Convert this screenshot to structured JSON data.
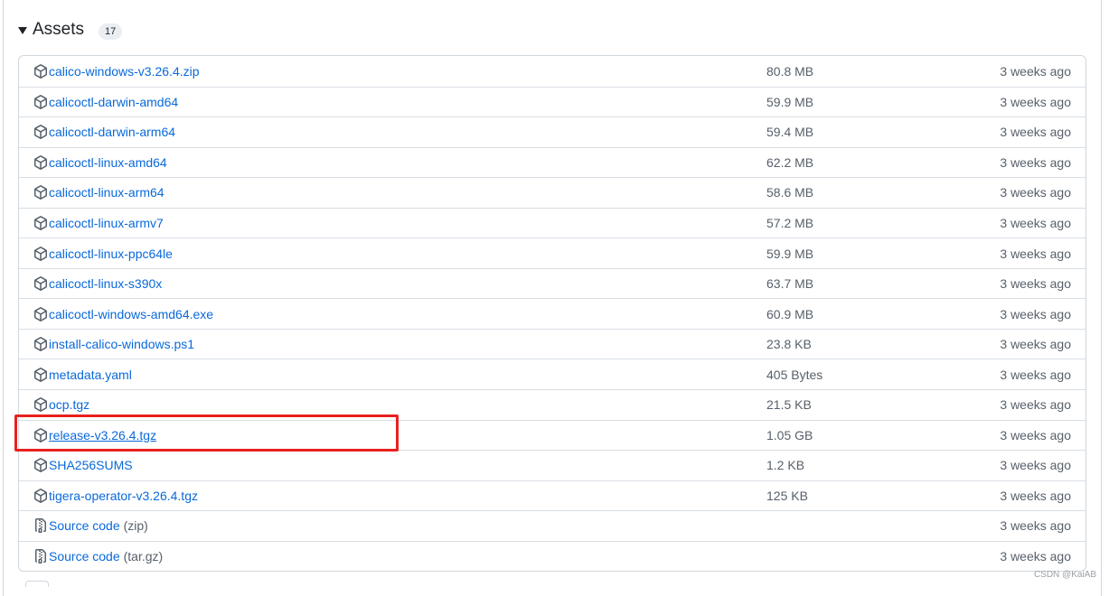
{
  "section": {
    "title": "Assets",
    "count": "17"
  },
  "assets": [
    {
      "name": "calico-windows-v3.26.4.zip",
      "size": "80.8 MB",
      "date": "3 weeks ago",
      "icon": "package-icon"
    },
    {
      "name": "calicoctl-darwin-amd64",
      "size": "59.9 MB",
      "date": "3 weeks ago",
      "icon": "package-icon"
    },
    {
      "name": "calicoctl-darwin-arm64",
      "size": "59.4 MB",
      "date": "3 weeks ago",
      "icon": "package-icon"
    },
    {
      "name": "calicoctl-linux-amd64",
      "size": "62.2 MB",
      "date": "3 weeks ago",
      "icon": "package-icon"
    },
    {
      "name": "calicoctl-linux-arm64",
      "size": "58.6 MB",
      "date": "3 weeks ago",
      "icon": "package-icon"
    },
    {
      "name": "calicoctl-linux-armv7",
      "size": "57.2 MB",
      "date": "3 weeks ago",
      "icon": "package-icon"
    },
    {
      "name": "calicoctl-linux-ppc64le",
      "size": "59.9 MB",
      "date": "3 weeks ago",
      "icon": "package-icon"
    },
    {
      "name": "calicoctl-linux-s390x",
      "size": "63.7 MB",
      "date": "3 weeks ago",
      "icon": "package-icon"
    },
    {
      "name": "calicoctl-windows-amd64.exe",
      "size": "60.9 MB",
      "date": "3 weeks ago",
      "icon": "package-icon"
    },
    {
      "name": "install-calico-windows.ps1",
      "size": "23.8 KB",
      "date": "3 weeks ago",
      "icon": "package-icon"
    },
    {
      "name": "metadata.yaml",
      "size": "405 Bytes",
      "date": "3 weeks ago",
      "icon": "package-icon"
    },
    {
      "name": "ocp.tgz",
      "size": "21.5 KB",
      "date": "3 weeks ago",
      "icon": "package-icon"
    },
    {
      "name": "release-v3.26.4.tgz",
      "size": "1.05 GB",
      "date": "3 weeks ago",
      "icon": "package-icon",
      "highlighted": true
    },
    {
      "name": "SHA256SUMS",
      "size": "1.2 KB",
      "date": "3 weeks ago",
      "icon": "package-icon"
    },
    {
      "name": "tigera-operator-v3.26.4.tgz",
      "size": "125 KB",
      "date": "3 weeks ago",
      "icon": "package-icon"
    },
    {
      "name": "Source code",
      "suffix": "(zip)",
      "size": "",
      "date": "3 weeks ago",
      "icon": "file-zip-icon"
    },
    {
      "name": "Source code",
      "suffix": "(tar.gz)",
      "size": "",
      "date": "3 weeks ago",
      "icon": "file-zip-icon"
    }
  ],
  "colors": {
    "link": "#0969da",
    "muted": "#57606a",
    "highlight": "#e8211f",
    "border": "#d0d7de"
  },
  "watermark": "CSDN @KaiAB"
}
